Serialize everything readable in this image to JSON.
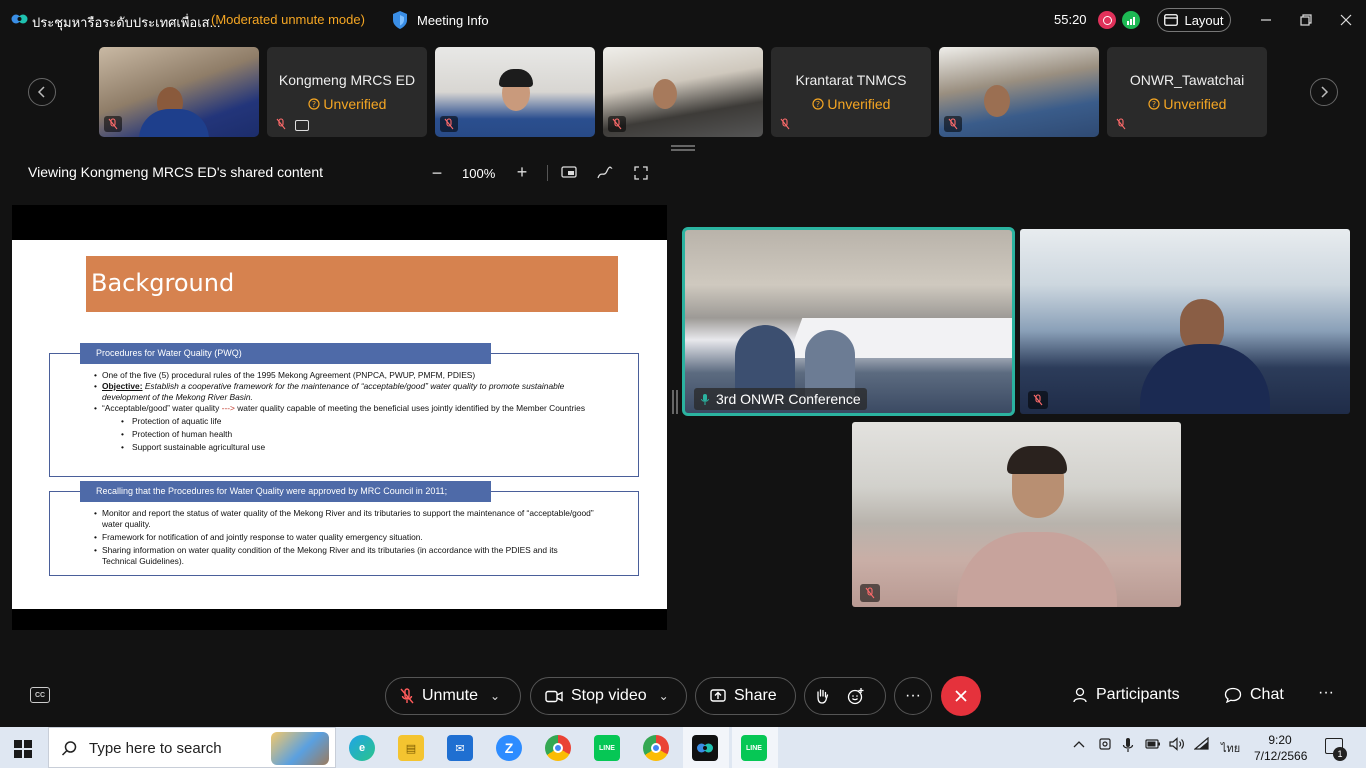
{
  "window": {
    "title": "ประชุมหารือระดับประเทศเพื่อเส...",
    "mode": "(Moderated unmute mode)",
    "meeting_info": "Meeting Info",
    "timer": "55:20",
    "layout": "Layout",
    "colors": {
      "accent_teal": "#2bb3a0",
      "warning": "#f5a623",
      "leave": "#e5323c",
      "record": "#e0315a"
    }
  },
  "thumbnails": [
    {
      "name": "",
      "status": "",
      "type": "video",
      "icons": [
        "mic-muted-icon"
      ]
    },
    {
      "name": "Kongmeng MRCS ED",
      "status": "Unverified",
      "type": "name",
      "icons": [
        "mic-muted-icon",
        "sharing-icon"
      ]
    },
    {
      "name": "",
      "status": "",
      "type": "video",
      "icons": [
        "mic-muted-icon"
      ]
    },
    {
      "name": "",
      "status": "",
      "type": "video",
      "icons": [
        "mic-muted-icon"
      ]
    },
    {
      "name": "Krantarat TNMCS",
      "status": "Unverified",
      "type": "name",
      "icons": [
        "mic-muted-icon"
      ]
    },
    {
      "name": "",
      "status": "",
      "type": "video",
      "icons": [
        "mic-muted-icon"
      ]
    },
    {
      "name": "ONWR_Tawatchai",
      "status": "Unverified",
      "type": "name",
      "icons": [
        "mic-muted-icon"
      ]
    }
  ],
  "share": {
    "viewing": "Viewing Kongmeng MRCS ED's shared content",
    "zoom_minus": "−",
    "zoom": "100%",
    "zoom_plus": "+"
  },
  "slide": {
    "title": "Background",
    "box1": {
      "header": "Procedures for Water Quality (PWQ)",
      "line1": "One of the five (5) procedural rules of the 1995 Mekong Agreement (PNPCA, PWUP, PMFM, PDIES)",
      "objective_label": "Objective:",
      "objective_text": " Establish a cooperative framework for the maintenance of “acceptable/good” water quality to promote sustainable development of the Mekong River Basin.",
      "line3_a": "“Acceptable/good” water quality ",
      "line3_arrow": "--->",
      "line3_b": " water quality capable of meeting the beneficial uses jointly identified by the Member Countries",
      "sub1": "Protection of aquatic life",
      "sub2": "Protection of human health",
      "sub3": "Support sustainable agricultural use"
    },
    "box2": {
      "header": "Recalling that the Procedures for Water Quality were approved by MRC Council in 2011;",
      "line1": "Monitor and report the status of water quality of the Mekong River and its tributaries to support the maintenance of “acceptable/good” water quality.",
      "line2": "Framework for notification of and jointly response to water quality emergency situation.",
      "line3": "Sharing information on water quality condition of the Mekong River and its tributaries (in accordance with the PDIES and its Technical Guidelines)."
    }
  },
  "video_grid": [
    {
      "label": "3rd ONWR Conference",
      "active": true,
      "muted": false
    },
    {
      "label": "",
      "active": false,
      "muted": true
    },
    {
      "label": "",
      "active": false,
      "muted": true
    }
  ],
  "toolbar": {
    "unmute": "Unmute",
    "stop_video": "Stop video",
    "share": "Share",
    "more": "···",
    "participants": "Participants",
    "chat": "Chat",
    "overflow": "···"
  },
  "taskbar": {
    "search_placeholder": "Type here to search",
    "time": "9:20",
    "date": "7/12/2566",
    "language": "ไทย",
    "notification_count": "1",
    "apps": [
      "edge",
      "file-explorer",
      "mail",
      "zoom",
      "chrome",
      "line",
      "chrome-profile",
      "webex",
      "line-active"
    ]
  }
}
